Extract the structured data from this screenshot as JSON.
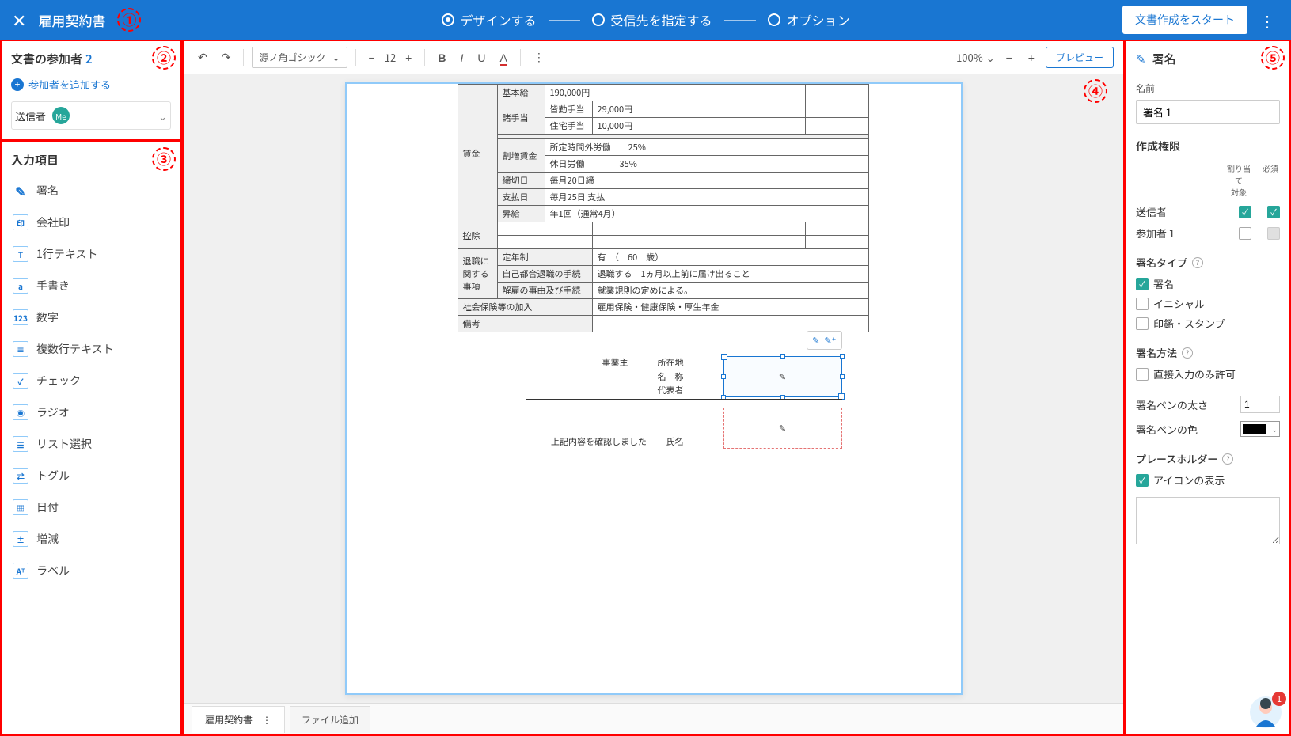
{
  "header": {
    "title": "雇用契約書",
    "steps": [
      {
        "label": "デザインする",
        "active": true
      },
      {
        "label": "受信先を指定する",
        "active": false
      },
      {
        "label": "オプション",
        "active": false
      }
    ],
    "start_label": "文書作成をスタート"
  },
  "participants": {
    "heading": "文書の参加者",
    "count": "2",
    "add_label": "参加者を追加する",
    "sender_label": "送信者",
    "me_badge": "Me"
  },
  "fields": {
    "heading": "入力項目",
    "items": [
      {
        "icon": "✎",
        "label": "署名"
      },
      {
        "icon": "印",
        "label": "会社印"
      },
      {
        "icon": "T",
        "label": "1行テキスト"
      },
      {
        "icon": "a",
        "label": "手書き"
      },
      {
        "icon": "123",
        "label": "数字"
      },
      {
        "icon": "≡",
        "label": "複数行テキスト"
      },
      {
        "icon": "✓",
        "label": "チェック"
      },
      {
        "icon": "◉",
        "label": "ラジオ"
      },
      {
        "icon": "☰",
        "label": "リスト選択"
      },
      {
        "icon": "⇄",
        "label": "トグル"
      },
      {
        "icon": "▦",
        "label": "日付"
      },
      {
        "icon": "±",
        "label": "増減"
      },
      {
        "icon": "Aᵀ",
        "label": "ラベル"
      }
    ]
  },
  "toolbar": {
    "font": "源ノ角ゴシック",
    "font_size": "12",
    "zoom": "100%",
    "preview": "プレビュー"
  },
  "document": {
    "table": {
      "wage_header": "賃金",
      "base_pay": {
        "label": "基本給",
        "value": "190,000円"
      },
      "allowance_header": "諸手当",
      "allowances": [
        {
          "label": "皆勤手当",
          "value": "29,000円"
        },
        {
          "label": "住宅手当",
          "value": "10,000円"
        }
      ],
      "overtime_header": "割増賃金",
      "overtime": [
        {
          "label": "所定時間外労働",
          "value": "25%"
        },
        {
          "label": "休日労働",
          "value": "35%"
        }
      ],
      "closing": {
        "label": "締切日",
        "value": "毎月20日締"
      },
      "payday": {
        "label": "支払日",
        "value": "毎月25日 支払"
      },
      "raise": {
        "label": "昇給",
        "value": "年1回（通常4月）"
      },
      "deduction": {
        "label": "控除"
      },
      "retirement_header": "退職に関する事項",
      "retire_age": {
        "label": "定年制",
        "value": "有　（　60　歳）"
      },
      "self_quit": {
        "label": "自己都合退職の手続",
        "value": "退職する　1ヵ月以上前に届け出ること"
      },
      "dismissal": {
        "label": "解雇の事由及び手続",
        "value": "就業規則の定めによる。"
      },
      "insurance": {
        "label": "社会保険等の加入",
        "value": "雇用保険・健康保険・厚生年金"
      },
      "remarks": {
        "label": "備考"
      }
    },
    "signatures": {
      "employer_label": "事業主",
      "addr": "所在地",
      "name": "名　称",
      "rep": "代表者",
      "confirm": "上記内容を確認しました",
      "person_name": "氏名"
    }
  },
  "tabs": {
    "active": "雇用契約書",
    "add": "ファイル追加"
  },
  "right": {
    "title": "署名",
    "name_label": "名前",
    "name_value": "署名１",
    "perm_heading": "作成権限",
    "perm_cols": {
      "assign": "割り当て\n対象",
      "required": "必須"
    },
    "perm_rows": [
      {
        "label": "送信者",
        "assign": true,
        "required": true
      },
      {
        "label": "参加者１",
        "assign": false,
        "required": "disabled"
      }
    ],
    "type_heading": "署名タイプ",
    "types": [
      {
        "label": "署名",
        "checked": true
      },
      {
        "label": "イニシャル",
        "checked": false
      },
      {
        "label": "印鑑・スタンプ",
        "checked": false
      }
    ],
    "method_heading": "署名方法",
    "method_direct": "直接入力のみ許可",
    "pen_width_label": "署名ペンの太さ",
    "pen_width_value": "1",
    "pen_color_label": "署名ペンの色",
    "placeholder_heading": "プレースホルダー",
    "show_icon": "アイコンの表示"
  },
  "annotations": [
    "①",
    "②",
    "③",
    "④",
    "⑤"
  ],
  "notif_count": "1"
}
